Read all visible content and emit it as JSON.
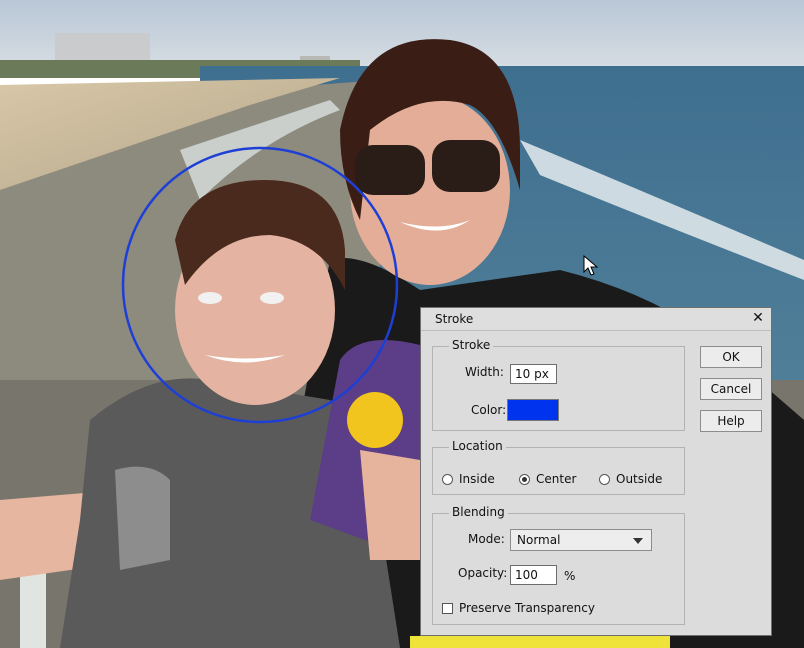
{
  "dialog": {
    "title": "Stroke",
    "close_glyph": "✕",
    "stroke": {
      "group_label": "Stroke",
      "width_label": "Width:",
      "width_value": "10 px",
      "color_label": "Color:",
      "color_value": "#0033ee"
    },
    "location": {
      "group_label": "Location",
      "options": [
        {
          "label": "Inside",
          "checked": false
        },
        {
          "label": "Center",
          "checked": true
        },
        {
          "label": "Outside",
          "checked": false
        }
      ]
    },
    "blending": {
      "group_label": "Blending",
      "mode_label": "Mode:",
      "mode_value": "Normal",
      "opacity_label": "Opacity:",
      "opacity_value": "100",
      "opacity_unit": "%",
      "preserve_label": "Preserve Transparency",
      "preserve_checked": false
    },
    "buttons": {
      "ok": "OK",
      "cancel": "Cancel",
      "help": "Help"
    }
  },
  "canvas": {
    "stroke_circle_color": "#1e3fd6"
  }
}
